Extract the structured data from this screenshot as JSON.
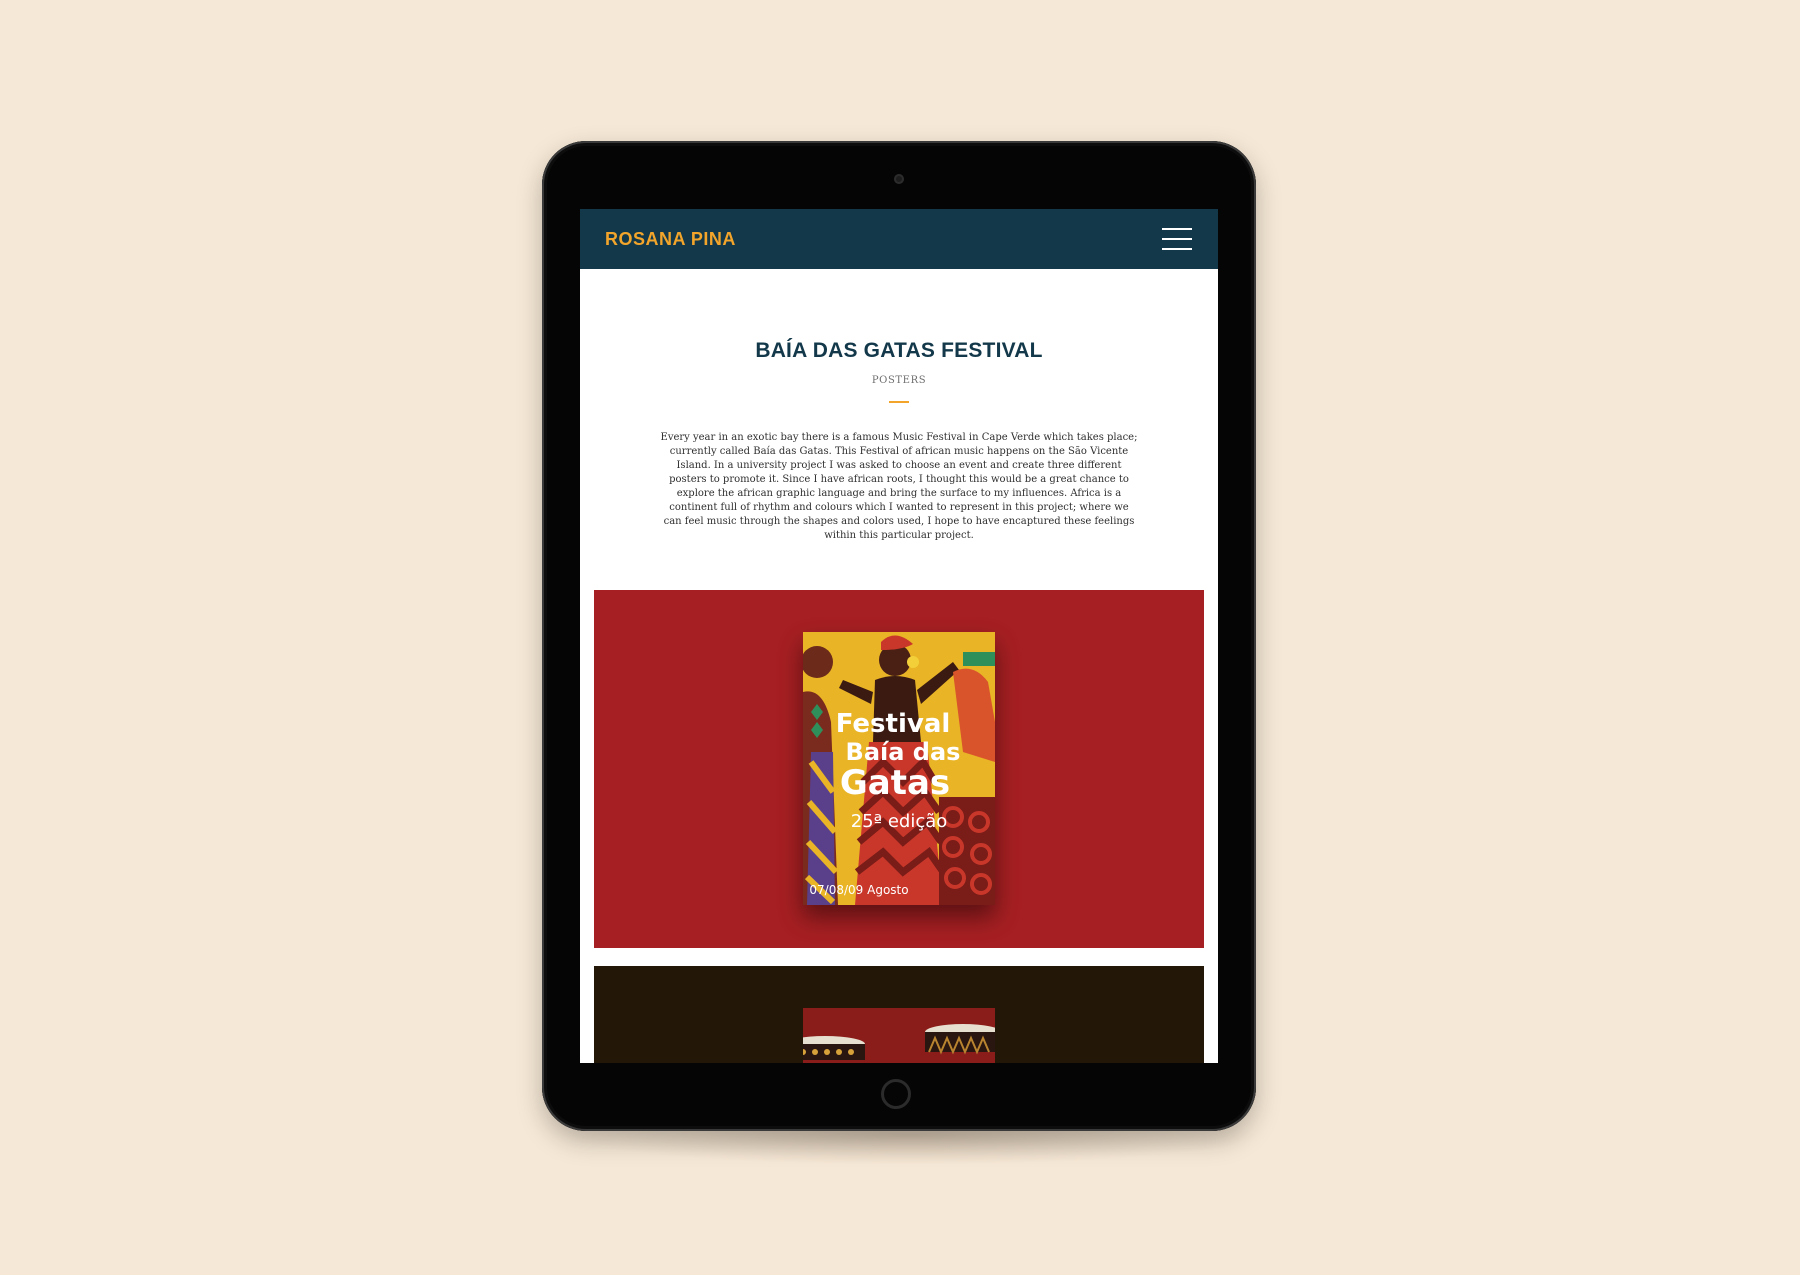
{
  "site": {
    "brand": "ROSANA PINA",
    "menu_icon": "hamburger-menu-icon"
  },
  "project": {
    "title": "BAÍA DAS GATAS FESTIVAL",
    "category": "POSTERS",
    "description": "Every year in an exotic bay there is a famous Music Festival in Cape Verde which takes place; currently called Baía das Gatas. This Festival of african music happens on the São Vicente Island. In a university project I was asked to choose an event and create three different posters to promote it. Since I have african roots, I thought this would be a great chance to explore the african graphic language and bring the surface to my influences. Africa is a continent full of rhythm and colours which I wanted to represent in this project; where we can feel music through the shapes and colors used, I hope to have encaptured these feelings within this particular project."
  },
  "poster1": {
    "line1": "Festival",
    "line2": "Baía das",
    "line3": "Gatas",
    "edition": "25ª edição",
    "dates": "07/08/09 Agosto"
  },
  "colors": {
    "page_bg": "#f6e8d6",
    "header_bg": "#12384a",
    "accent": "#f2a52a",
    "panel_red": "#a61f22",
    "panel_dark": "#231708"
  }
}
